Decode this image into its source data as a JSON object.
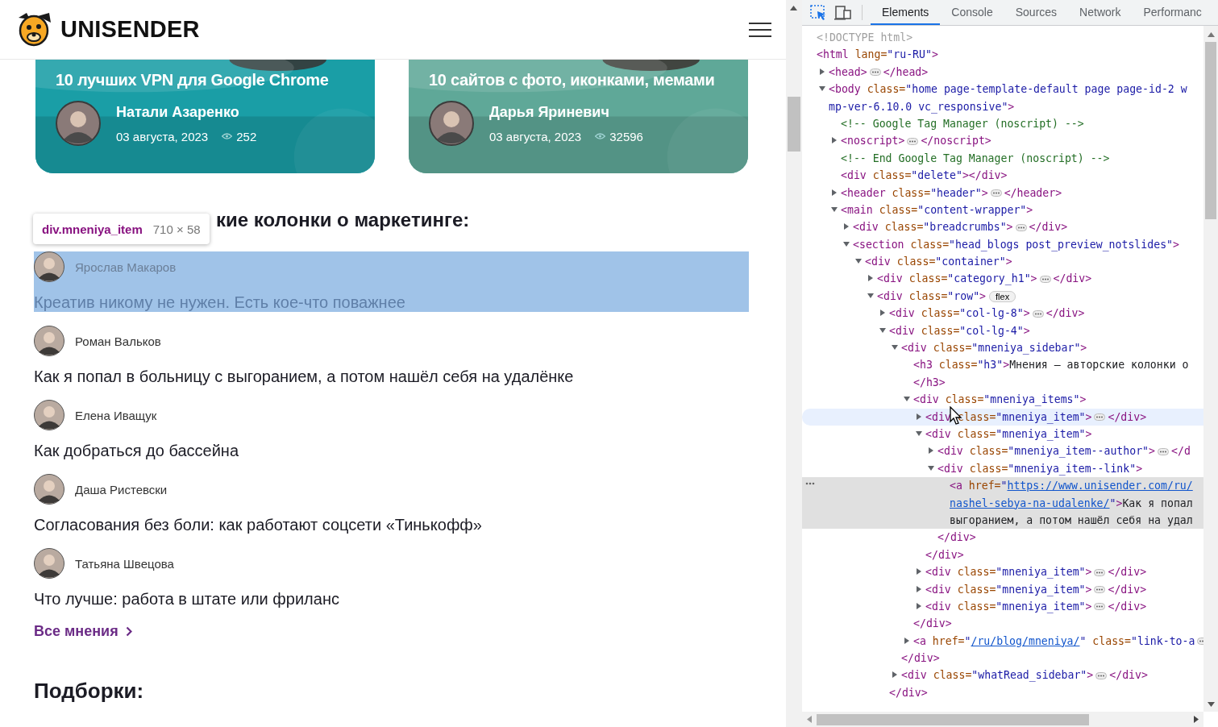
{
  "header": {
    "logo_text": "UNISENDER"
  },
  "cards": [
    {
      "title": "10 лучших VPN для Google Chrome",
      "author": "Натали Азаренко",
      "date": "03 августа, 2023",
      "views": "252",
      "color": "#1a9ea6"
    },
    {
      "title": "10 сайтов с фото, иконками, мемами",
      "author": "Дарья Яриневич",
      "date": "03 августа, 2023",
      "views": "32596",
      "color": "#5fa898"
    }
  ],
  "opinions": {
    "heading": "кие колонки о маркетинге:",
    "tooltip": {
      "selector": "div.mneniya_item",
      "size": "710 × 58"
    },
    "items": [
      {
        "author": "Ярослав Макаров",
        "title": "Креатив никому не нужен. Есть кое-что поважнее",
        "highlighted": true
      },
      {
        "author": "Роман Вальков",
        "title": "Как я попал в больницу с выгоранием, а потом нашёл себя на удалёнке",
        "highlighted": false
      },
      {
        "author": "Елена Иващук",
        "title": "Как добраться до бассейна",
        "highlighted": false
      },
      {
        "author": "Даша Ристевски",
        "title": "Согласования без боли: как работают соцсети «Тинькофф»",
        "highlighted": false
      },
      {
        "author": "Татьяна Швецова",
        "title": "Что лучше: работа в штате или фриланс",
        "highlighted": false
      }
    ],
    "all_link": "Все мнения"
  },
  "section_heading": "Подборки:",
  "devtools": {
    "tabs": [
      {
        "label": "Elements",
        "selected": true
      },
      {
        "label": "Console",
        "selected": false
      },
      {
        "label": "Sources",
        "selected": false
      },
      {
        "label": "Network",
        "selected": false
      },
      {
        "label": "Performanc",
        "selected": false
      }
    ],
    "tree": [
      {
        "kind": "doctype",
        "lines": [
          "<!DOCTYPE html>"
        ]
      },
      {
        "kind": "element",
        "lines": [
          "<html lang=\"ru-RU\">"
        ],
        "children": [
          {
            "kind": "element",
            "lines": [
              "<head>"
            ],
            "expanded": false,
            "close": "</head>"
          },
          {
            "kind": "element",
            "lines": [
              "<body class=\"home page-template-default page page-id-2 w",
              "mp-ver-6.10.0 vc_responsive\">"
            ],
            "expanded": true,
            "children": [
              {
                "kind": "comment",
                "lines": [
                  "<!-- Google Tag Manager (noscript) -->"
                ]
              },
              {
                "kind": "element",
                "lines": [
                  "<noscript>"
                ],
                "expanded": false,
                "close": "</noscript>"
              },
              {
                "kind": "comment",
                "lines": [
                  "<!-- End Google Tag Manager (noscript) -->"
                ]
              },
              {
                "kind": "element",
                "lines": [
                  "<div class=\"delete\"></div>"
                ]
              },
              {
                "kind": "element",
                "lines": [
                  "<header class=\"header\">"
                ],
                "expanded": false,
                "close": "</header>"
              },
              {
                "kind": "element",
                "lines": [
                  "<main class=\"content-wrapper\">"
                ],
                "expanded": true,
                "children": [
                  {
                    "kind": "element",
                    "lines": [
                      "<div class=\"breadcrumbs\">"
                    ],
                    "expanded": false,
                    "close": "</div>"
                  },
                  {
                    "kind": "element",
                    "lines": [
                      "<section class=\"head_blogs post_preview_notslides\">"
                    ],
                    "expanded": true,
                    "children": [
                      {
                        "kind": "element",
                        "lines": [
                          "<div class=\"container\">"
                        ],
                        "expanded": true,
                        "children": [
                          {
                            "kind": "element",
                            "lines": [
                              "<div class=\"category_h1\">"
                            ],
                            "expanded": false,
                            "close": "</div>"
                          },
                          {
                            "kind": "element",
                            "lines": [
                              "<div class=\"row\">"
                            ],
                            "badge": "flex",
                            "expanded": true,
                            "children": [
                              {
                                "kind": "element",
                                "lines": [
                                  "<div class=\"col-lg-8\">"
                                ],
                                "expanded": false,
                                "close": "</div>"
                              },
                              {
                                "kind": "element",
                                "lines": [
                                  "<div class=\"col-lg-4\">"
                                ],
                                "expanded": true,
                                "children": [
                                  {
                                    "kind": "element",
                                    "lines": [
                                      "<div class=\"mneniya_sidebar\">"
                                    ],
                                    "expanded": true,
                                    "children": [
                                      {
                                        "kind": "element",
                                        "lines": [
                                          "<h3 class=\"h3\">Мнения — авторские колонки о",
                                          "</h3>"
                                        ]
                                      },
                                      {
                                        "kind": "element",
                                        "lines": [
                                          "<div class=\"mneniya_items\">"
                                        ],
                                        "expanded": true,
                                        "children": [
                                          {
                                            "kind": "element",
                                            "lines": [
                                              "<div class=\"mneniya_item\">"
                                            ],
                                            "expanded": false,
                                            "close": "</div>",
                                            "hovered": true
                                          },
                                          {
                                            "kind": "element",
                                            "lines": [
                                              "<div class=\"mneniya_item\">"
                                            ],
                                            "expanded": true,
                                            "children": [
                                              {
                                                "kind": "element",
                                                "lines": [
                                                  "<div class=\"mneniya_item--author\">"
                                                ],
                                                "expanded": false,
                                                "close": "</d"
                                              },
                                              {
                                                "kind": "element",
                                                "lines": [
                                                  "<div class=\"mneniya_item--link\">"
                                                ],
                                                "expanded": true,
                                                "children": [
                                                  {
                                                    "kind": "element",
                                                    "lines": [
                                                      "<a href=\"https://www.unisender.com/ru/",
                                                      "nashel-sebya-na-udalenke/\">Как я попал",
                                                      "выгоранием, а потом нашёл себя на удал"
                                                    ],
                                                    "selected": true
                                                  }
                                                ],
                                                "close_line": "</div>"
                                              }
                                            ],
                                            "close_line": "</div>"
                                          },
                                          {
                                            "kind": "element",
                                            "lines": [
                                              "<div class=\"mneniya_item\">"
                                            ],
                                            "expanded": false,
                                            "close": "</div>"
                                          },
                                          {
                                            "kind": "element",
                                            "lines": [
                                              "<div class=\"mneniya_item\">"
                                            ],
                                            "expanded": false,
                                            "close": "</div>"
                                          },
                                          {
                                            "kind": "element",
                                            "lines": [
                                              "<div class=\"mneniya_item\">"
                                            ],
                                            "expanded": false,
                                            "close": "</div>"
                                          }
                                        ],
                                        "close_line": "</div>"
                                      },
                                      {
                                        "kind": "element",
                                        "lines": [
                                          "<a href=\"/ru/blog/mneniya/\" class=\"link-to-a"
                                        ],
                                        "expanded": false
                                      }
                                    ],
                                    "close_line": "</div>"
                                  },
                                  {
                                    "kind": "element",
                                    "lines": [
                                      "<div class=\"whatRead_sidebar\">"
                                    ],
                                    "expanded": false,
                                    "close": "</div>"
                                  }
                                ],
                                "close_line": "</div>"
                              }
                            ]
                          }
                        ]
                      }
                    ]
                  }
                ]
              }
            ]
          }
        ]
      }
    ]
  }
}
